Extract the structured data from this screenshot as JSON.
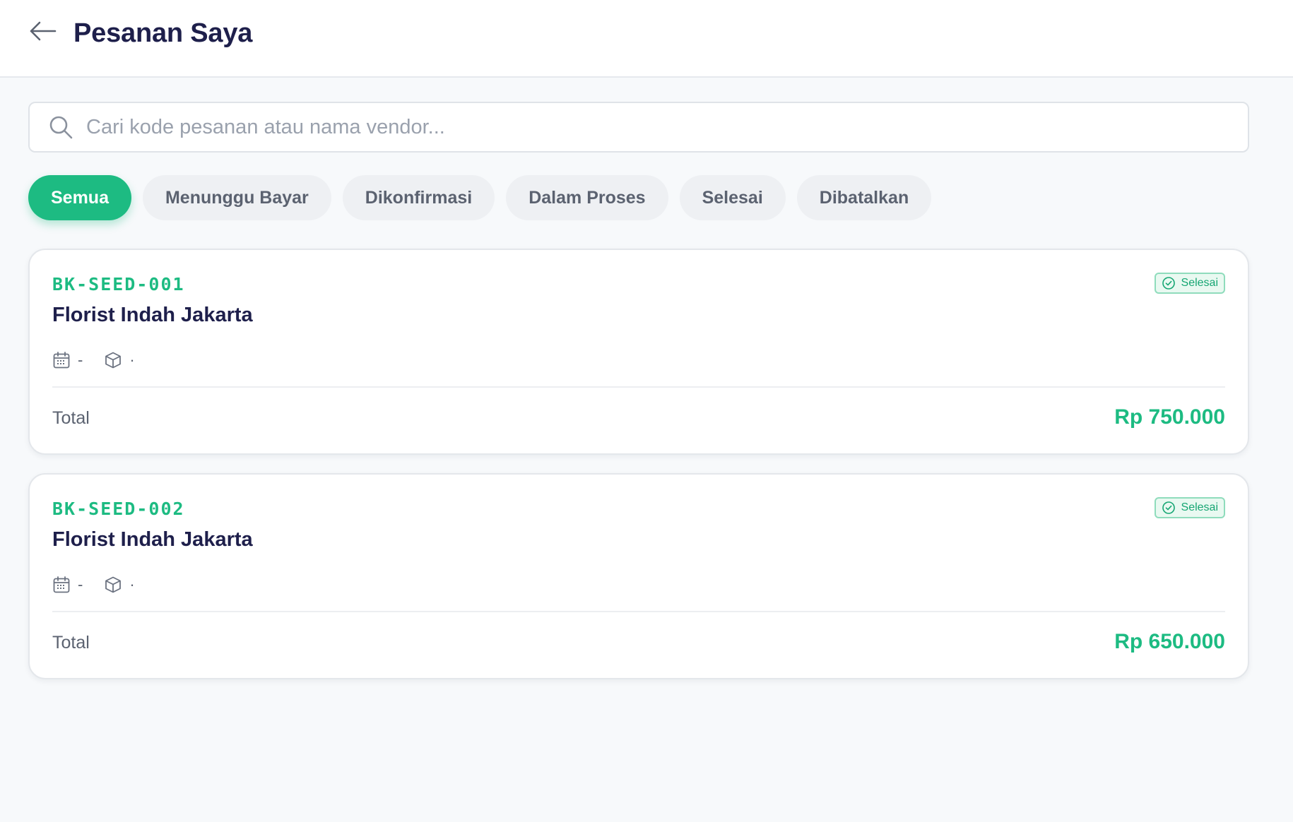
{
  "header": {
    "title": "Pesanan Saya",
    "back_icon": "arrow-left-icon"
  },
  "search": {
    "placeholder": "Cari kode pesanan atau nama vendor...",
    "value": "",
    "icon": "search-icon"
  },
  "filters": [
    {
      "label": "Semua",
      "active": true
    },
    {
      "label": "Menunggu Bayar",
      "active": false
    },
    {
      "label": "Dikonfirmasi",
      "active": false
    },
    {
      "label": "Dalam Proses",
      "active": false
    },
    {
      "label": "Selesai",
      "active": false
    },
    {
      "label": "Dibatalkan",
      "active": false
    }
  ],
  "orders": [
    {
      "code": "BK-SEED-001",
      "vendor": "Florist Indah Jakarta",
      "status": "Selesai",
      "date": "-",
      "package": "·",
      "total_label": "Total",
      "total": "Rp 750.000"
    },
    {
      "code": "BK-SEED-002",
      "vendor": "Florist Indah Jakarta",
      "status": "Selesai",
      "date": "-",
      "package": "·",
      "total_label": "Total",
      "total": "Rp 650.000"
    }
  ],
  "colors": {
    "accent": "#1dbb82",
    "title": "#1e1f4b",
    "muted": "#5b6270",
    "background": "#f7f9fb"
  }
}
